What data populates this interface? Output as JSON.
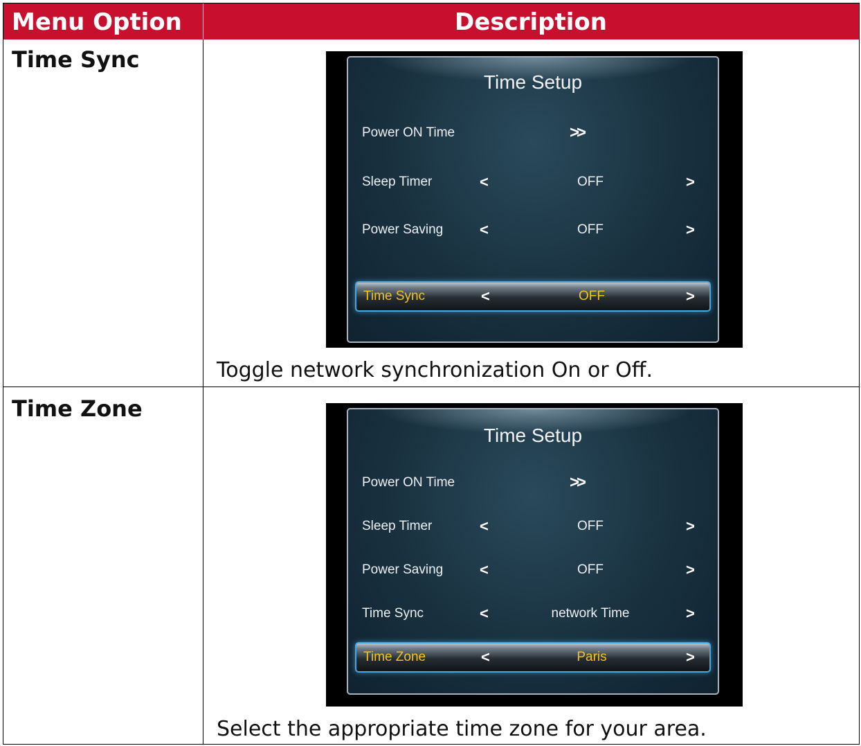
{
  "header": {
    "col1": "Menu Option",
    "col2": "Description"
  },
  "rows": [
    {
      "option": "Time Sync",
      "screen": {
        "title": "Time Setup",
        "items": [
          {
            "label": "Power ON Time",
            "value": ">>"
          },
          {
            "label": "Sleep Timer",
            "left": "<",
            "value": "OFF",
            "right": ">"
          },
          {
            "label": "Power Saving",
            "left": "<",
            "value": "OFF",
            "right": ">"
          },
          {
            "label": "Time Sync",
            "left": "<",
            "value": "OFF",
            "right": ">"
          }
        ]
      },
      "description": "Toggle network synchronization On or Off."
    },
    {
      "option": "Time Zone",
      "screen": {
        "title": "Time Setup",
        "items": [
          {
            "label": "Power ON Time",
            "value": ">>"
          },
          {
            "label": "Sleep Timer",
            "left": "<",
            "value": "OFF",
            "right": ">"
          },
          {
            "label": "Power Saving",
            "left": "<",
            "value": "OFF",
            "right": ">"
          },
          {
            "label": "Time Sync",
            "left": "<",
            "value": "network Time",
            "right": ">"
          },
          {
            "label": "Time Zone",
            "left": "<",
            "value": "Paris",
            "right": ">"
          }
        ]
      },
      "description": "Select the appropriate time zone for your area."
    }
  ],
  "colors": {
    "header_bg": "#c8102e",
    "selected_text": "#f2c518",
    "selected_border": "#4aa8df"
  }
}
